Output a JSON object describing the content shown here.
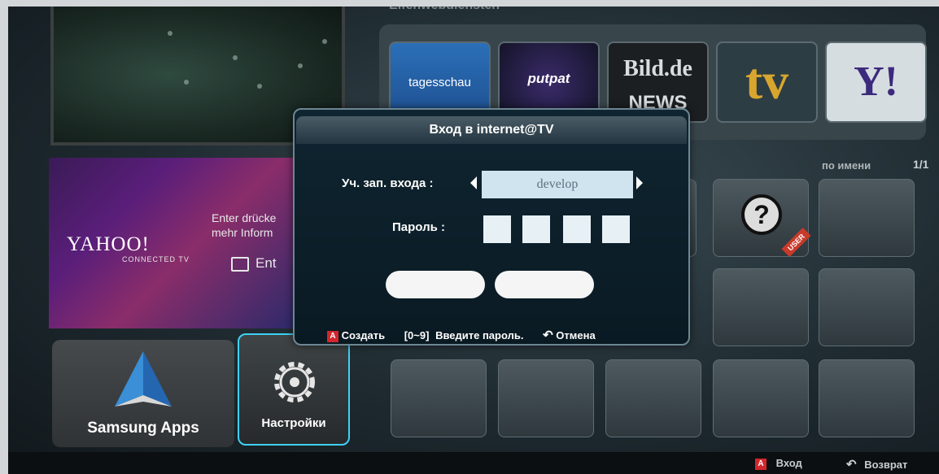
{
  "top_label": "• Elfenwebdiensten",
  "apps": [
    {
      "name": "tagesschau",
      "label": "tagesschau"
    },
    {
      "name": "putpat",
      "label": "putpat"
    },
    {
      "name": "bild",
      "label": "Bild.de",
      "sub": "NEWS"
    },
    {
      "name": "tv",
      "label": "tv"
    },
    {
      "name": "yahoo",
      "label": "Y!"
    }
  ],
  "yahoo_banner": {
    "logo": "YAHOO!",
    "connected": "CONNECTED TV",
    "line1": "Enter drücke",
    "line2": "mehr Inform",
    "enter": "Ent"
  },
  "tiles": {
    "samsung_apps": "Samsung Apps",
    "settings": "Настройки"
  },
  "sort": {
    "label": "по имени",
    "page": "1/1"
  },
  "user_badge": "USER",
  "question_mark": "?",
  "dialog": {
    "title": "Вход в internet@TV",
    "account_label": "Уч. зап. входа :",
    "account_value": "develop",
    "password_label": "Пароль :",
    "hints": {
      "create_key": "A",
      "create": "Создать",
      "digits": "[0~9]",
      "enter_password": "Введите пароль.",
      "cancel": "Отмена"
    }
  },
  "bottom_bar": {
    "login_key": "A",
    "login": "Вход",
    "back": "Возврат"
  }
}
